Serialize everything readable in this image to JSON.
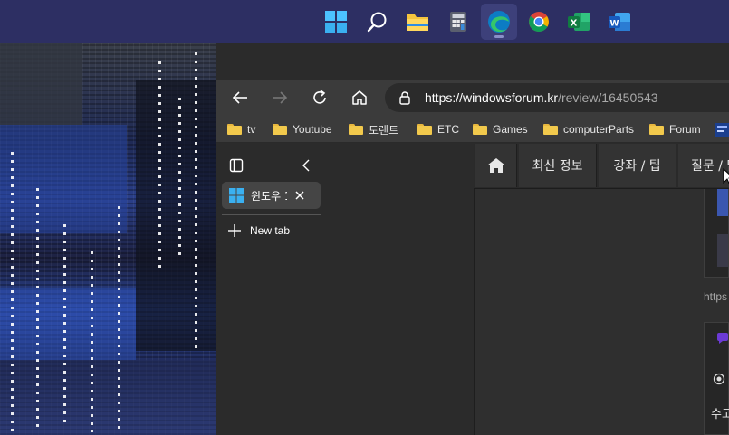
{
  "taskbar": {
    "apps": [
      {
        "name": "windows-start",
        "active": false
      },
      {
        "name": "search",
        "active": false
      },
      {
        "name": "file-explorer",
        "active": false
      },
      {
        "name": "calculator",
        "active": false
      },
      {
        "name": "edge",
        "active": true
      },
      {
        "name": "chrome",
        "active": false
      },
      {
        "name": "excel",
        "active": false
      },
      {
        "name": "word",
        "active": false
      }
    ]
  },
  "browser": {
    "address": {
      "host": "https://windowsforum.kr",
      "path": "/review/16450543"
    },
    "bookmarks": [
      "tv",
      "Youtube",
      "토렌트",
      "ETC",
      "Games",
      "computerParts",
      "Forum"
    ],
    "tabs": [
      {
        "label": "윈도우 1",
        "icon": "windows-logo-icon"
      }
    ],
    "new_tab_label": "New tab"
  },
  "site": {
    "nav": [
      "최신 정보",
      "강좌 / 팁",
      "질문 / 답"
    ],
    "partial_url": "https",
    "partial_text": "수고"
  },
  "colors": {
    "taskbar": "#2d2f63",
    "browser_toolbar": "#3b3b3b",
    "tab_panel": "#2b2b2b",
    "page_bg": "#2f2f2f",
    "accent_purple": "#6c3ad6"
  }
}
